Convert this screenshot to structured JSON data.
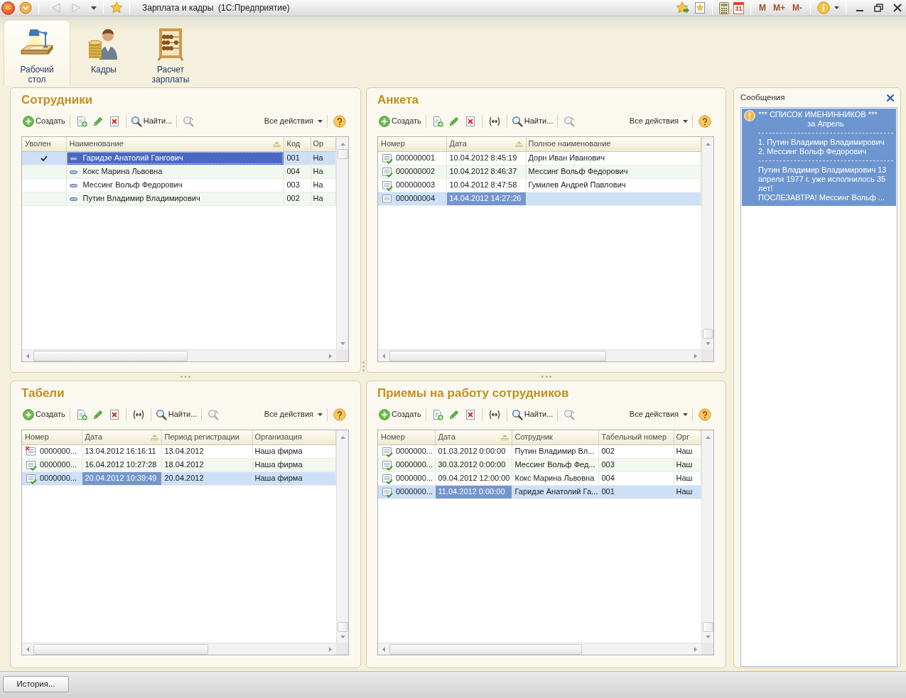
{
  "window": {
    "logo": "1С",
    "title": "Зарплата и кадры  (1С:Предприятие)",
    "calendar_day": "31",
    "memory_buttons": [
      "M",
      "M+",
      "M-"
    ]
  },
  "sections": [
    {
      "label": "Рабочий стол",
      "selected": true
    },
    {
      "label": "Кадры",
      "selected": false
    },
    {
      "label": "Расчет зарплаты",
      "selected": false
    }
  ],
  "panels": [
    {
      "title": "Сотрудники",
      "focused": true,
      "toolbar": {
        "create": "Создать",
        "find": "Найти...",
        "all_actions": "Все действия",
        "period_button": false
      },
      "table": {
        "columns": [
          {
            "label": "Уволен",
            "kind": "check",
            "sorted": false,
            "current": false
          },
          {
            "label": "Наименование",
            "kind": "element",
            "sorted": true,
            "current": true
          },
          {
            "label": "Код",
            "kind": "text",
            "sorted": false,
            "current": false
          },
          {
            "label": "Ор",
            "kind": "text",
            "sorted": false,
            "current": false
          }
        ],
        "rows": [
          {
            "selected": true,
            "dismissed": true,
            "cells": [
              "",
              "Гаридзе Анатолий Гангович",
              "001",
              "На"
            ]
          },
          {
            "selected": false,
            "dismissed": false,
            "cells": [
              "",
              "Кокс Марина Львовна",
              "004",
              "На"
            ]
          },
          {
            "selected": false,
            "dismissed": false,
            "cells": [
              "",
              "Мессинг Вольф Федорович",
              "003",
              "На"
            ]
          },
          {
            "selected": false,
            "dismissed": false,
            "cells": [
              "",
              "Путин Владимир Владимирович",
              "002",
              "На"
            ]
          }
        ]
      }
    },
    {
      "title": "Анкета",
      "focused": false,
      "toolbar": {
        "create": "Создать",
        "find": "Найти...",
        "all_actions": "Все действия",
        "period_button": true
      },
      "table": {
        "columns": [
          {
            "label": "Номер",
            "kind": "document",
            "sorted": false,
            "current": false
          },
          {
            "label": "Дата",
            "kind": "text",
            "sorted": true,
            "current": true
          },
          {
            "label": "Полное наименование",
            "kind": "text",
            "sorted": false,
            "current": false
          }
        ],
        "rows": [
          {
            "selected": false,
            "posted": true,
            "deletion_mark": false,
            "cells": [
              "000000001",
              "10.04.2012 8:45:19",
              "Дорн Иван Иванович"
            ]
          },
          {
            "selected": false,
            "posted": true,
            "deletion_mark": false,
            "cells": [
              "000000002",
              "10.04.2012 8:46:37",
              "Мессинг Вольф Федорович"
            ]
          },
          {
            "selected": false,
            "posted": true,
            "deletion_mark": false,
            "cells": [
              "000000003",
              "10.04.2012 8:47:58",
              "Гумилев Андрей Павлович"
            ]
          },
          {
            "selected": true,
            "posted": false,
            "deletion_mark": false,
            "cells": [
              "000000004",
              "14.04.2012 14:27:26"
            ]
          }
        ]
      }
    },
    {
      "title": "Табели",
      "focused": false,
      "toolbar": {
        "create": "Создать",
        "find": "Найти...",
        "all_actions": "Все действия",
        "period_button": true
      },
      "table": {
        "columns": [
          {
            "label": "Номер",
            "kind": "document",
            "sorted": false,
            "current": false
          },
          {
            "label": "Дата",
            "kind": "text",
            "sorted": true,
            "current": true
          },
          {
            "label": "Период регистрации",
            "kind": "text",
            "sorted": false,
            "current": false
          },
          {
            "label": "Организация",
            "kind": "text",
            "sorted": false,
            "current": false
          }
        ],
        "rows": [
          {
            "selected": false,
            "posted": false,
            "deletion_mark": true,
            "cells": [
              "0000000...",
              "13.04.2012 16:16:11",
              "13.04.2012",
              "Наша фирма"
            ]
          },
          {
            "selected": false,
            "posted": true,
            "deletion_mark": false,
            "cells": [
              "0000000...",
              "16.04.2012 10:27:28",
              "18.04.2012",
              "Наша фирма"
            ]
          },
          {
            "selected": true,
            "posted": true,
            "deletion_mark": false,
            "cells": [
              "0000000...",
              "20.04.2012 10:39:49",
              "20.04.2012",
              "Наша фирма"
            ]
          }
        ]
      }
    },
    {
      "title": "Приемы на работу сотрудников",
      "focused": false,
      "toolbar": {
        "create": "Создать",
        "find": "Найти...",
        "all_actions": "Все действия",
        "period_button": true
      },
      "table": {
        "columns": [
          {
            "label": "Номер",
            "kind": "document",
            "sorted": false,
            "current": false
          },
          {
            "label": "Дата",
            "kind": "text",
            "sorted": true,
            "current": true
          },
          {
            "label": "Сотрудник",
            "kind": "text",
            "sorted": false,
            "current": false
          },
          {
            "label": "Табельный номер",
            "kind": "text",
            "sorted": false,
            "current": false
          },
          {
            "label": "Орг",
            "kind": "text",
            "sorted": false,
            "current": false
          }
        ],
        "rows": [
          {
            "selected": false,
            "posted": true,
            "deletion_mark": false,
            "cells": [
              "0000000...",
              "01.03.2012 0:00:00",
              "Путин Владимир Вл...",
              "002",
              "Наш"
            ]
          },
          {
            "selected": false,
            "posted": true,
            "deletion_mark": false,
            "cells": [
              "0000000...",
              "30.03.2012 0:00:00",
              "Мессинг Вольф Фед...",
              "003",
              "Наш"
            ]
          },
          {
            "selected": false,
            "posted": true,
            "deletion_mark": false,
            "cells": [
              "0000000...",
              "09.04.2012 12:00:00",
              "Кокс Марина Львовна",
              "004",
              "Наш"
            ]
          },
          {
            "selected": true,
            "posted": true,
            "deletion_mark": false,
            "cells": [
              "0000000...",
              "11.04.2012 0:00:00",
              "Гаридзе Анатолий Га...",
              "001",
              "Наш"
            ]
          }
        ]
      }
    }
  ],
  "messages": {
    "title": "Сообщения",
    "heading": "*** СПИСОК ИМЕНИННИКОВ ***",
    "subheading": "за Апрель",
    "list": [
      "1. Путин Владимир Владимирович",
      "2. Мессинг Вольф Федорович"
    ],
    "paragraphs": [
      "Путин Владимир Владимирович 13 апреля 1977 г. уже исполнилось 35 лет!",
      "ПОСЛЕЗАВТРА! Мессинг Вольф ..."
    ]
  },
  "footer": {
    "history_button": "История..."
  }
}
